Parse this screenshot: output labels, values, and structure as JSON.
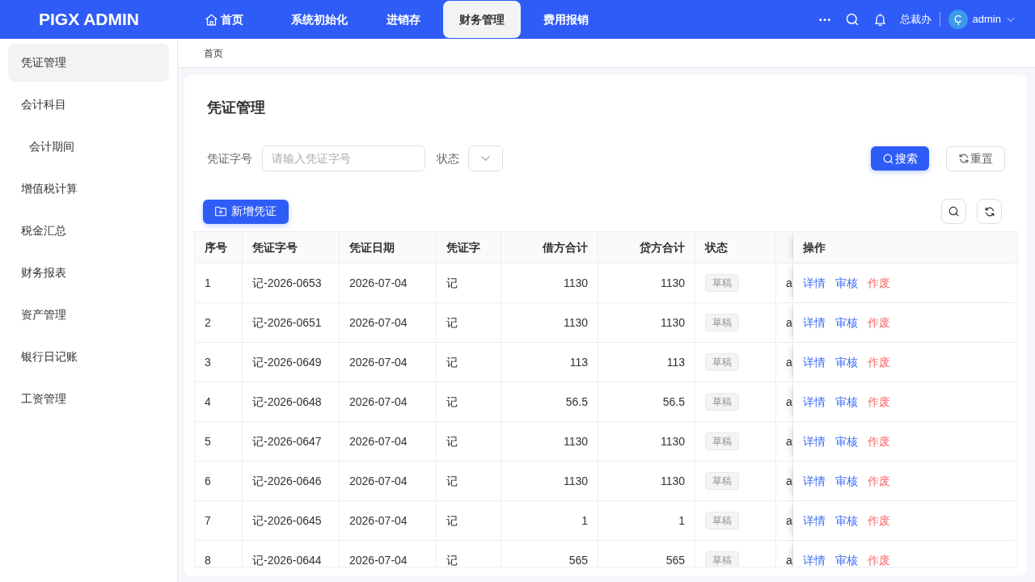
{
  "header": {
    "logo": "PIGX ADMIN",
    "nav": [
      {
        "label": "首页",
        "kind": "with_icon",
        "selected": false
      },
      {
        "label": "系统初始化",
        "kind": "plain",
        "selected": false
      },
      {
        "label": "进销存",
        "kind": "plain",
        "selected": false
      },
      {
        "label": "财务管理",
        "kind": "plain",
        "selected": true
      },
      {
        "label": "费用报销",
        "kind": "plain",
        "selected": false
      }
    ],
    "org": "总裁办",
    "user": {
      "avatar": "Ç",
      "name": "admin"
    }
  },
  "sidebar": {
    "items": [
      {
        "label": "凭证管理",
        "selected": true
      },
      {
        "label": "会计科目",
        "selected": false,
        "children": [
          {
            "label": "会计期间",
            "selected": false
          }
        ]
      },
      {
        "label": "增值税计算",
        "selected": false
      },
      {
        "label": "税金汇总",
        "selected": false
      },
      {
        "label": "财务报表",
        "selected": false
      },
      {
        "label": "资产管理",
        "selected": false
      },
      {
        "label": "银行日记账",
        "selected": false
      },
      {
        "label": "工资管理",
        "selected": false
      }
    ]
  },
  "breadcrumb": [
    "首页"
  ],
  "page": {
    "title": "凭证管理",
    "filters": [
      {
        "kind": "text",
        "label": "凭证字号",
        "placeholder": "请输入凭证字号"
      },
      {
        "kind": "select",
        "label": "状态"
      }
    ],
    "search_button": "搜索",
    "reset_button": "重置",
    "add_button": "新增凭证"
  },
  "table": {
    "columns": [
      {
        "label": "序号",
        "kind": "text"
      },
      {
        "label": "凭证字号",
        "kind": "text"
      },
      {
        "label": "凭证日期",
        "kind": "text"
      },
      {
        "label": "凭证字",
        "kind": "text"
      },
      {
        "label": "借方合计",
        "kind": "number"
      },
      {
        "label": "贷方合计",
        "kind": "number"
      },
      {
        "label": "状态",
        "kind": "tag"
      }
    ],
    "action_column": "操作",
    "rows": [
      {
        "cells": [
          "1",
          "记-2026-0653",
          "2026-07-04",
          "记",
          "1130",
          "1130",
          "草稿"
        ],
        "column_8": "a",
        "actions": [
          {
            "label": "详情",
            "kind": "primary"
          },
          {
            "label": "审核",
            "kind": "primary"
          },
          {
            "label": "作废",
            "kind": "danger"
          }
        ]
      },
      {
        "cells": [
          "2",
          "记-2026-0651",
          "2026-07-04",
          "记",
          "1130",
          "1130",
          "草稿"
        ],
        "column_8": "a",
        "actions": [
          {
            "label": "详情",
            "kind": "primary"
          },
          {
            "label": "审核",
            "kind": "primary"
          },
          {
            "label": "作废",
            "kind": "danger"
          }
        ]
      },
      {
        "cells": [
          "3",
          "记-2026-0649",
          "2026-07-04",
          "记",
          "113",
          "113",
          "草稿"
        ],
        "column_8": "a",
        "actions": [
          {
            "label": "详情",
            "kind": "primary"
          },
          {
            "label": "审核",
            "kind": "primary"
          },
          {
            "label": "作废",
            "kind": "danger"
          }
        ]
      },
      {
        "cells": [
          "4",
          "记-2026-0648",
          "2026-07-04",
          "记",
          "56.5",
          "56.5",
          "草稿"
        ],
        "column_8": "a",
        "actions": [
          {
            "label": "详情",
            "kind": "primary"
          },
          {
            "label": "审核",
            "kind": "primary"
          },
          {
            "label": "作废",
            "kind": "danger"
          }
        ]
      },
      {
        "cells": [
          "5",
          "记-2026-0647",
          "2026-07-04",
          "记",
          "1130",
          "1130",
          "草稿"
        ],
        "column_8": "a",
        "actions": [
          {
            "label": "详情",
            "kind": "primary"
          },
          {
            "label": "审核",
            "kind": "primary"
          },
          {
            "label": "作废",
            "kind": "danger"
          }
        ]
      },
      {
        "cells": [
          "6",
          "记-2026-0646",
          "2026-07-04",
          "记",
          "1130",
          "1130",
          "草稿"
        ],
        "column_8": "a",
        "actions": [
          {
            "label": "详情",
            "kind": "primary"
          },
          {
            "label": "审核",
            "kind": "primary"
          },
          {
            "label": "作废",
            "kind": "danger"
          }
        ]
      },
      {
        "cells": [
          "7",
          "记-2026-0645",
          "2026-07-04",
          "记",
          "1",
          "1",
          "草稿"
        ],
        "column_8": "a",
        "actions": [
          {
            "label": "详情",
            "kind": "primary"
          },
          {
            "label": "审核",
            "kind": "primary"
          },
          {
            "label": "作废",
            "kind": "danger"
          }
        ]
      },
      {
        "cells": [
          "8",
          "记-2026-0644",
          "2026-07-04",
          "记",
          "565",
          "565",
          "草稿"
        ],
        "column_8": "a",
        "actions": [
          {
            "label": "详情",
            "kind": "primary"
          },
          {
            "label": "审核",
            "kind": "primary"
          },
          {
            "label": "作废",
            "kind": "danger"
          }
        ]
      }
    ]
  }
}
